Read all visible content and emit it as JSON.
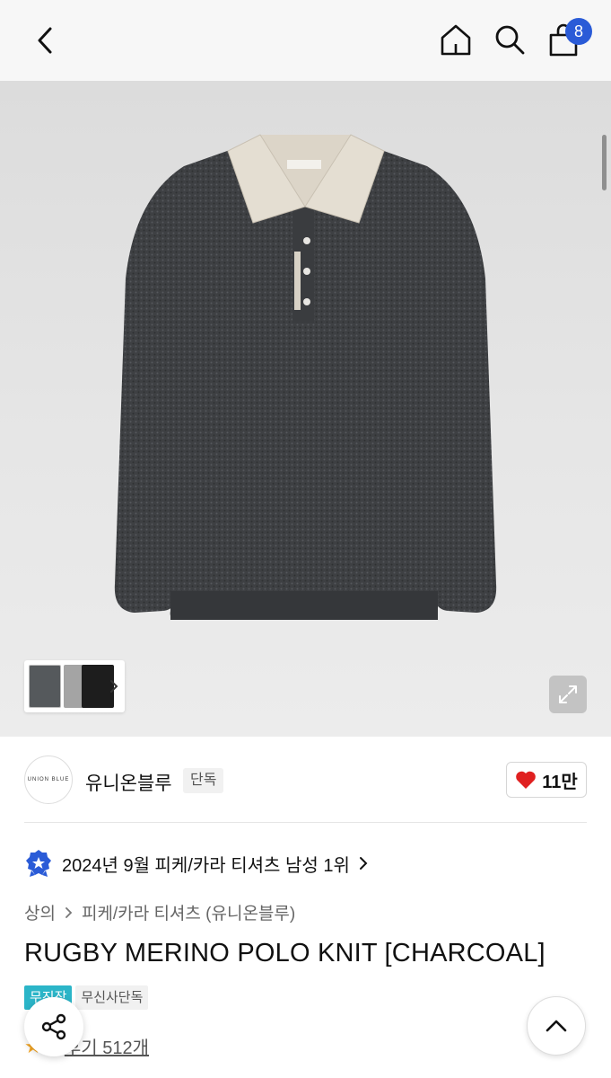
{
  "header": {
    "back_icon": "chevron-left-icon",
    "home_icon": "home-icon",
    "search_icon": "search-icon",
    "bag_icon": "shopping-bag-icon",
    "bag_count": "8",
    "badge_color": "#2a5bd7"
  },
  "product_image": {
    "subject": "charcoal rugby merino polo knit sweater",
    "expand_icon": "expand-icon",
    "thumbnail_more_icon": "chevron-right-icon"
  },
  "brand": {
    "logo_text": "UNION BLUE",
    "name": "유니온블루",
    "exclusive_tag": "단독",
    "like_count": "11만",
    "like_icon": "heart-icon",
    "heart_color": "#e02020"
  },
  "ranking": {
    "icon": "ranking-medal-icon",
    "text": "2024년 9월 피케/카라 티셔츠 남성 1위"
  },
  "breadcrumb": {
    "items": [
      "상의",
      "피케/카라 티셔츠 (유니온블루)"
    ]
  },
  "product": {
    "title": "RUGBY MERINO POLO KNIT [CHARCOAL]",
    "tags": [
      "무진장",
      "무신사단독"
    ],
    "tag_accent": "#2bb5c8",
    "rating_visible": "9",
    "review_label": "후기 512개"
  },
  "floating": {
    "share_icon": "share-icon",
    "scroll_top_icon": "chevron-up-icon"
  }
}
